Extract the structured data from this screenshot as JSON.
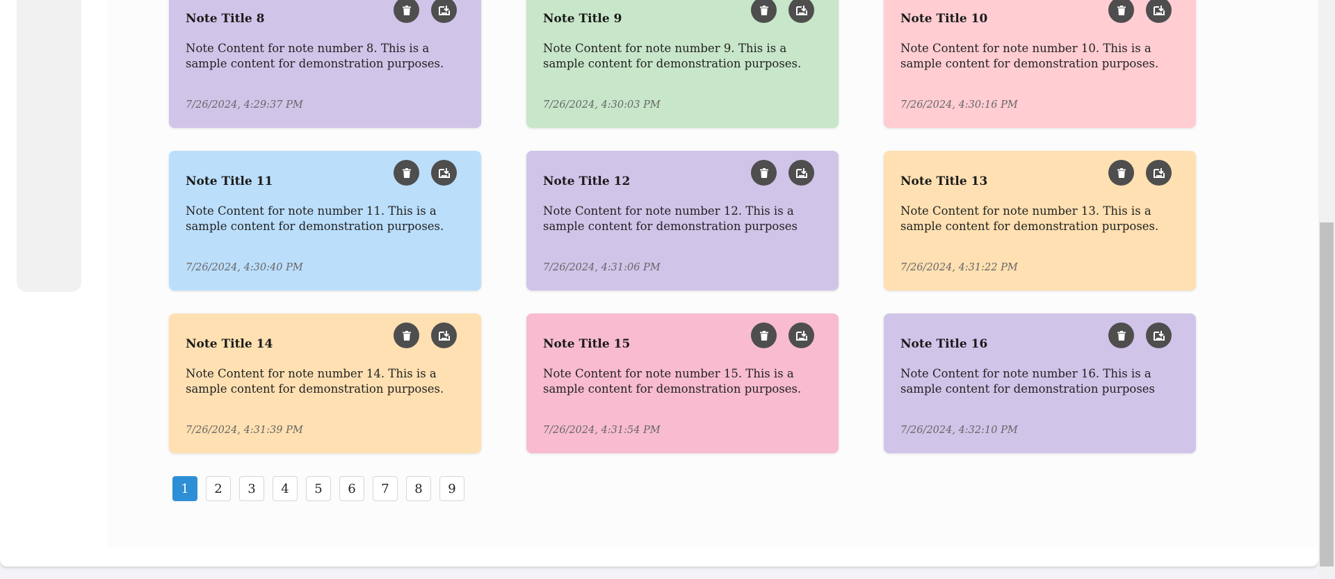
{
  "notes": [
    {
      "title": "Note Title 8",
      "content": "Note Content for note number 8. This is a sample content for demonstration purposes.",
      "date": "7/26/2024, 4:29:37 PM",
      "color": "#d1c4e9"
    },
    {
      "title": "Note Title 9",
      "content": "Note Content for note number 9. This is a sample content for demonstration purposes.",
      "date": "7/26/2024, 4:30:03 PM",
      "color": "#c8e6c9"
    },
    {
      "title": "Note Title 10",
      "content": "Note Content for note number 10. This is a sample content for demonstration purposes.",
      "date": "7/26/2024, 4:30:16 PM",
      "color": "#ffcdd2"
    },
    {
      "title": "Note Title 11",
      "content": "Note Content for note number 11. This is a sample content for demonstration purposes.",
      "date": "7/26/2024, 4:30:40 PM",
      "color": "#bbdefb"
    },
    {
      "title": "Note Title 12",
      "content": "Note Content for note number 12. This is a sample content for demonstration purposes",
      "date": "7/26/2024, 4:31:06 PM",
      "color": "#d1c4e9"
    },
    {
      "title": "Note Title 13",
      "content": "Note Content for note number 13. This is a sample content for demonstration purposes.",
      "date": "7/26/2024, 4:31:22 PM",
      "color": "#ffe0b2"
    },
    {
      "title": "Note Title 14",
      "content": "Note Content for note number 14. This is a sample content for demonstration purposes.",
      "date": "7/26/2024, 4:31:39 PM",
      "color": "#ffe0b2"
    },
    {
      "title": "Note Title 15",
      "content": "Note Content for note number 15. This is a sample content for demonstration purposes.",
      "date": "7/26/2024, 4:31:54 PM",
      "color": "#f8bbd0"
    },
    {
      "title": "Note Title 16",
      "content": "Note Content for note number 16. This is a sample content for demonstration purposes",
      "date": "7/26/2024, 4:32:10 PM",
      "color": "#d1c4e9"
    }
  ],
  "note_actions": {
    "delete_icon": "trash-icon",
    "export_icon": "export-icon",
    "icon_bg": "#4e4e4e"
  },
  "pagination": {
    "pages": [
      "1",
      "2",
      "3",
      "4",
      "5",
      "6",
      "7",
      "8",
      "9"
    ],
    "current": "1",
    "active_color": "#2f8fd6"
  }
}
